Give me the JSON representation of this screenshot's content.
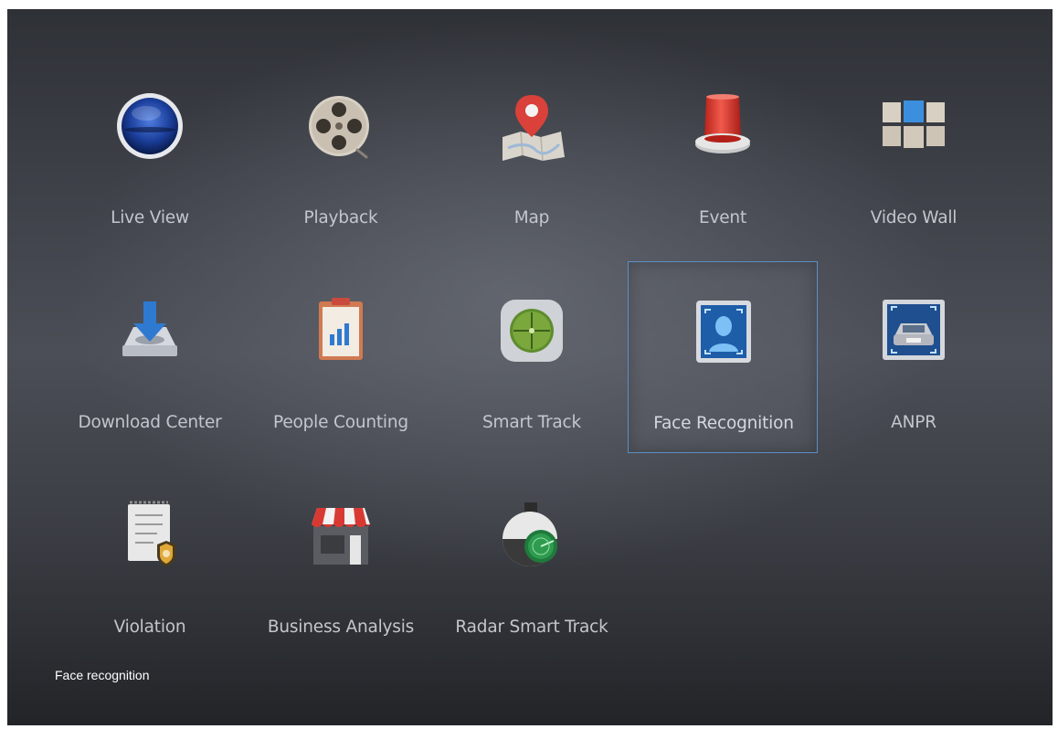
{
  "apps": [
    {
      "label": "Live View",
      "icon": "live-view-icon"
    },
    {
      "label": "Playback",
      "icon": "playback-reel-icon"
    },
    {
      "label": "Map",
      "icon": "map-pin-icon"
    },
    {
      "label": "Event",
      "icon": "alarm-light-icon"
    },
    {
      "label": "Video Wall",
      "icon": "video-wall-grid-icon"
    },
    {
      "label": "Download Center",
      "icon": "download-tray-icon"
    },
    {
      "label": "People Counting",
      "icon": "clipboard-chart-icon"
    },
    {
      "label": "Smart Track",
      "icon": "crosshair-target-icon"
    },
    {
      "label": "Face Recognition",
      "icon": "face-scan-icon"
    },
    {
      "label": "ANPR",
      "icon": "car-plate-scan-icon"
    },
    {
      "label": "Violation",
      "icon": "police-report-icon"
    },
    {
      "label": "Business Analysis",
      "icon": "storefront-icon"
    },
    {
      "label": "Radar Smart Track",
      "icon": "radar-camera-icon"
    }
  ],
  "selected_app": "Face Recognition",
  "status_text": "Face recognition",
  "colors": {
    "selection_border": "#5c8fc4",
    "label_text": "#c3c6cc",
    "status_text": "#ffffff"
  }
}
